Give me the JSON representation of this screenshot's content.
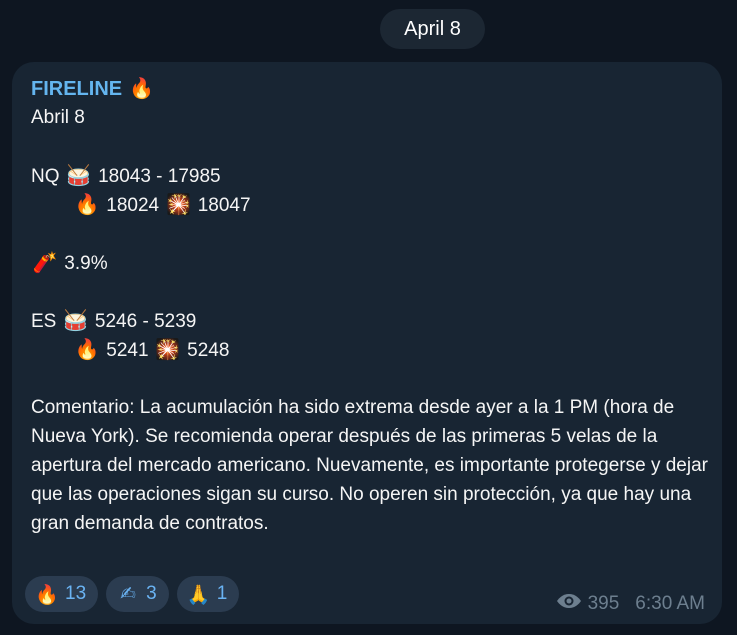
{
  "date_label": "April 8",
  "message": {
    "sender": "FIRELINE",
    "sender_emoji": "🔥",
    "subtitle": "Abril 8",
    "nq": {
      "label": "NQ",
      "range": "18043 - 17985",
      "fire_value": "18024",
      "target_value": "18047"
    },
    "dynamite_value": "3.9%",
    "es": {
      "label": "ES",
      "range": "5246 - 5239",
      "fire_value": "5241",
      "target_value": "5248"
    },
    "comment": "Comentario: La acumulación ha sido extrema desde ayer a la 1 PM (hora de Nueva York). Se recomienda operar después de las primeras 5 velas de la apertura del mercado americano. Nuevamente, es importante protegerse y dejar que las operaciones sigan su curso. No operen sin protección, ya que hay una gran demanda de contratos."
  },
  "reactions": [
    {
      "emoji": "🔥",
      "count": "13",
      "icon": "fire-icon"
    },
    {
      "emoji": "✍",
      "count": "3",
      "icon": "writing-hand-icon"
    },
    {
      "emoji": "🙏",
      "count": "1",
      "icon": "praying-hands-icon"
    }
  ],
  "views": "395",
  "time": "6:30 AM",
  "icons": {
    "drum": "🥁",
    "fire": "🔥",
    "target": "🎇",
    "dynamite": "🧨",
    "eye": "eye-icon"
  },
  "colors": {
    "background": "#0e1621",
    "bubble": "#182533",
    "sender": "#64b5ef",
    "reaction_bg": "#2b3c50",
    "reaction_text": "#6ab3f3",
    "meta": "#6d7f8f"
  }
}
